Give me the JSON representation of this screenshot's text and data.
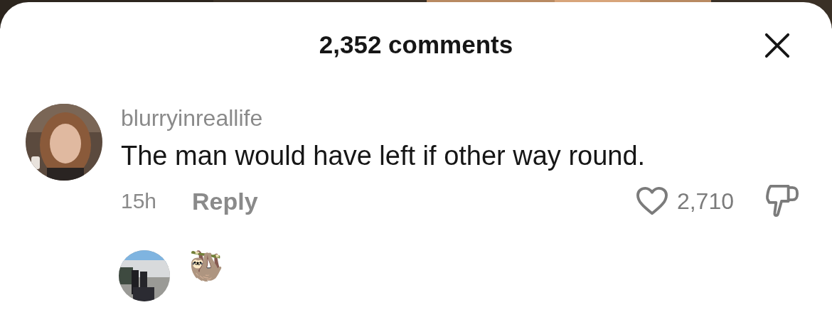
{
  "sheet": {
    "title": "2,352 comments"
  },
  "comments": [
    {
      "username": "blurryinreallife",
      "text": "The man would have left if other way round.",
      "time": "15h",
      "reply_label": "Reply",
      "likes": "2,710",
      "liked": false
    }
  ],
  "replies": [
    {
      "username": "🦥"
    }
  ]
}
